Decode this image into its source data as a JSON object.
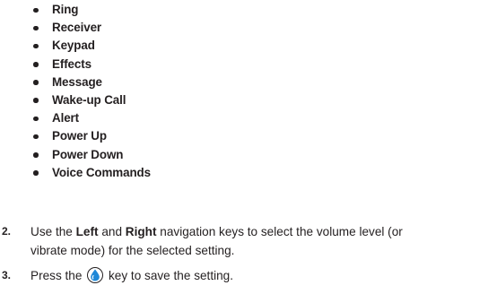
{
  "bullet_items": [
    "Ring",
    "Receiver",
    "Keypad",
    "Effects",
    "Message",
    "Wake-up Call",
    "Alert",
    "Power Up",
    "Power Down",
    "Voice Commands"
  ],
  "step2": {
    "number": "2.",
    "t1": "Use the ",
    "b1": "Left",
    "t2": " and ",
    "b2": "Right",
    "t3": " navigation keys to select the volume level (or",
    "line2": "vibrate mode) for the selected setting."
  },
  "step3": {
    "number": "3.",
    "t1": "Press the",
    "icon": "ok-key-icon",
    "t2": "key to save the setting."
  }
}
